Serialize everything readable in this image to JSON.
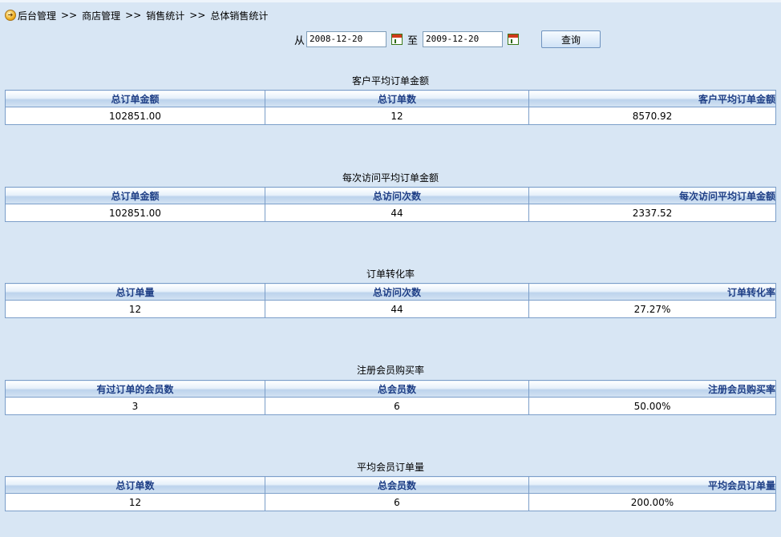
{
  "breadcrumb": [
    "后台管理",
    "商店管理",
    "销售统计",
    "总体销售统计"
  ],
  "breadcrumb_separator": ">>",
  "filter": {
    "from_label": "从",
    "from_date": "2008-12-20",
    "to_label": "至",
    "to_date": "2009-12-20",
    "query_label": "查询"
  },
  "sections": [
    {
      "title": "客户平均订单金额",
      "headers": [
        "总订单金额",
        "总订单数",
        "客户平均订单金额"
      ],
      "values": [
        "102851.00",
        "12",
        "8570.92"
      ]
    },
    {
      "title": "每次访问平均订单金额",
      "headers": [
        "总订单金额",
        "总访问次数",
        "每次访问平均订单金额"
      ],
      "values": [
        "102851.00",
        "44",
        "2337.52"
      ]
    },
    {
      "title": "订单转化率",
      "headers": [
        "总订单量",
        "总访问次数",
        "订单转化率"
      ],
      "values": [
        "12",
        "44",
        "27.27%"
      ]
    },
    {
      "title": "注册会员购买率",
      "headers": [
        "有过订单的会员数",
        "总会员数",
        "注册会员购买率"
      ],
      "values": [
        "3",
        "6",
        "50.00%"
      ]
    },
    {
      "title": "平均会员订单量",
      "headers": [
        "总订单数",
        "总会员数",
        "平均会员订单量"
      ],
      "values": [
        "12",
        "6",
        "200.00%"
      ]
    }
  ]
}
